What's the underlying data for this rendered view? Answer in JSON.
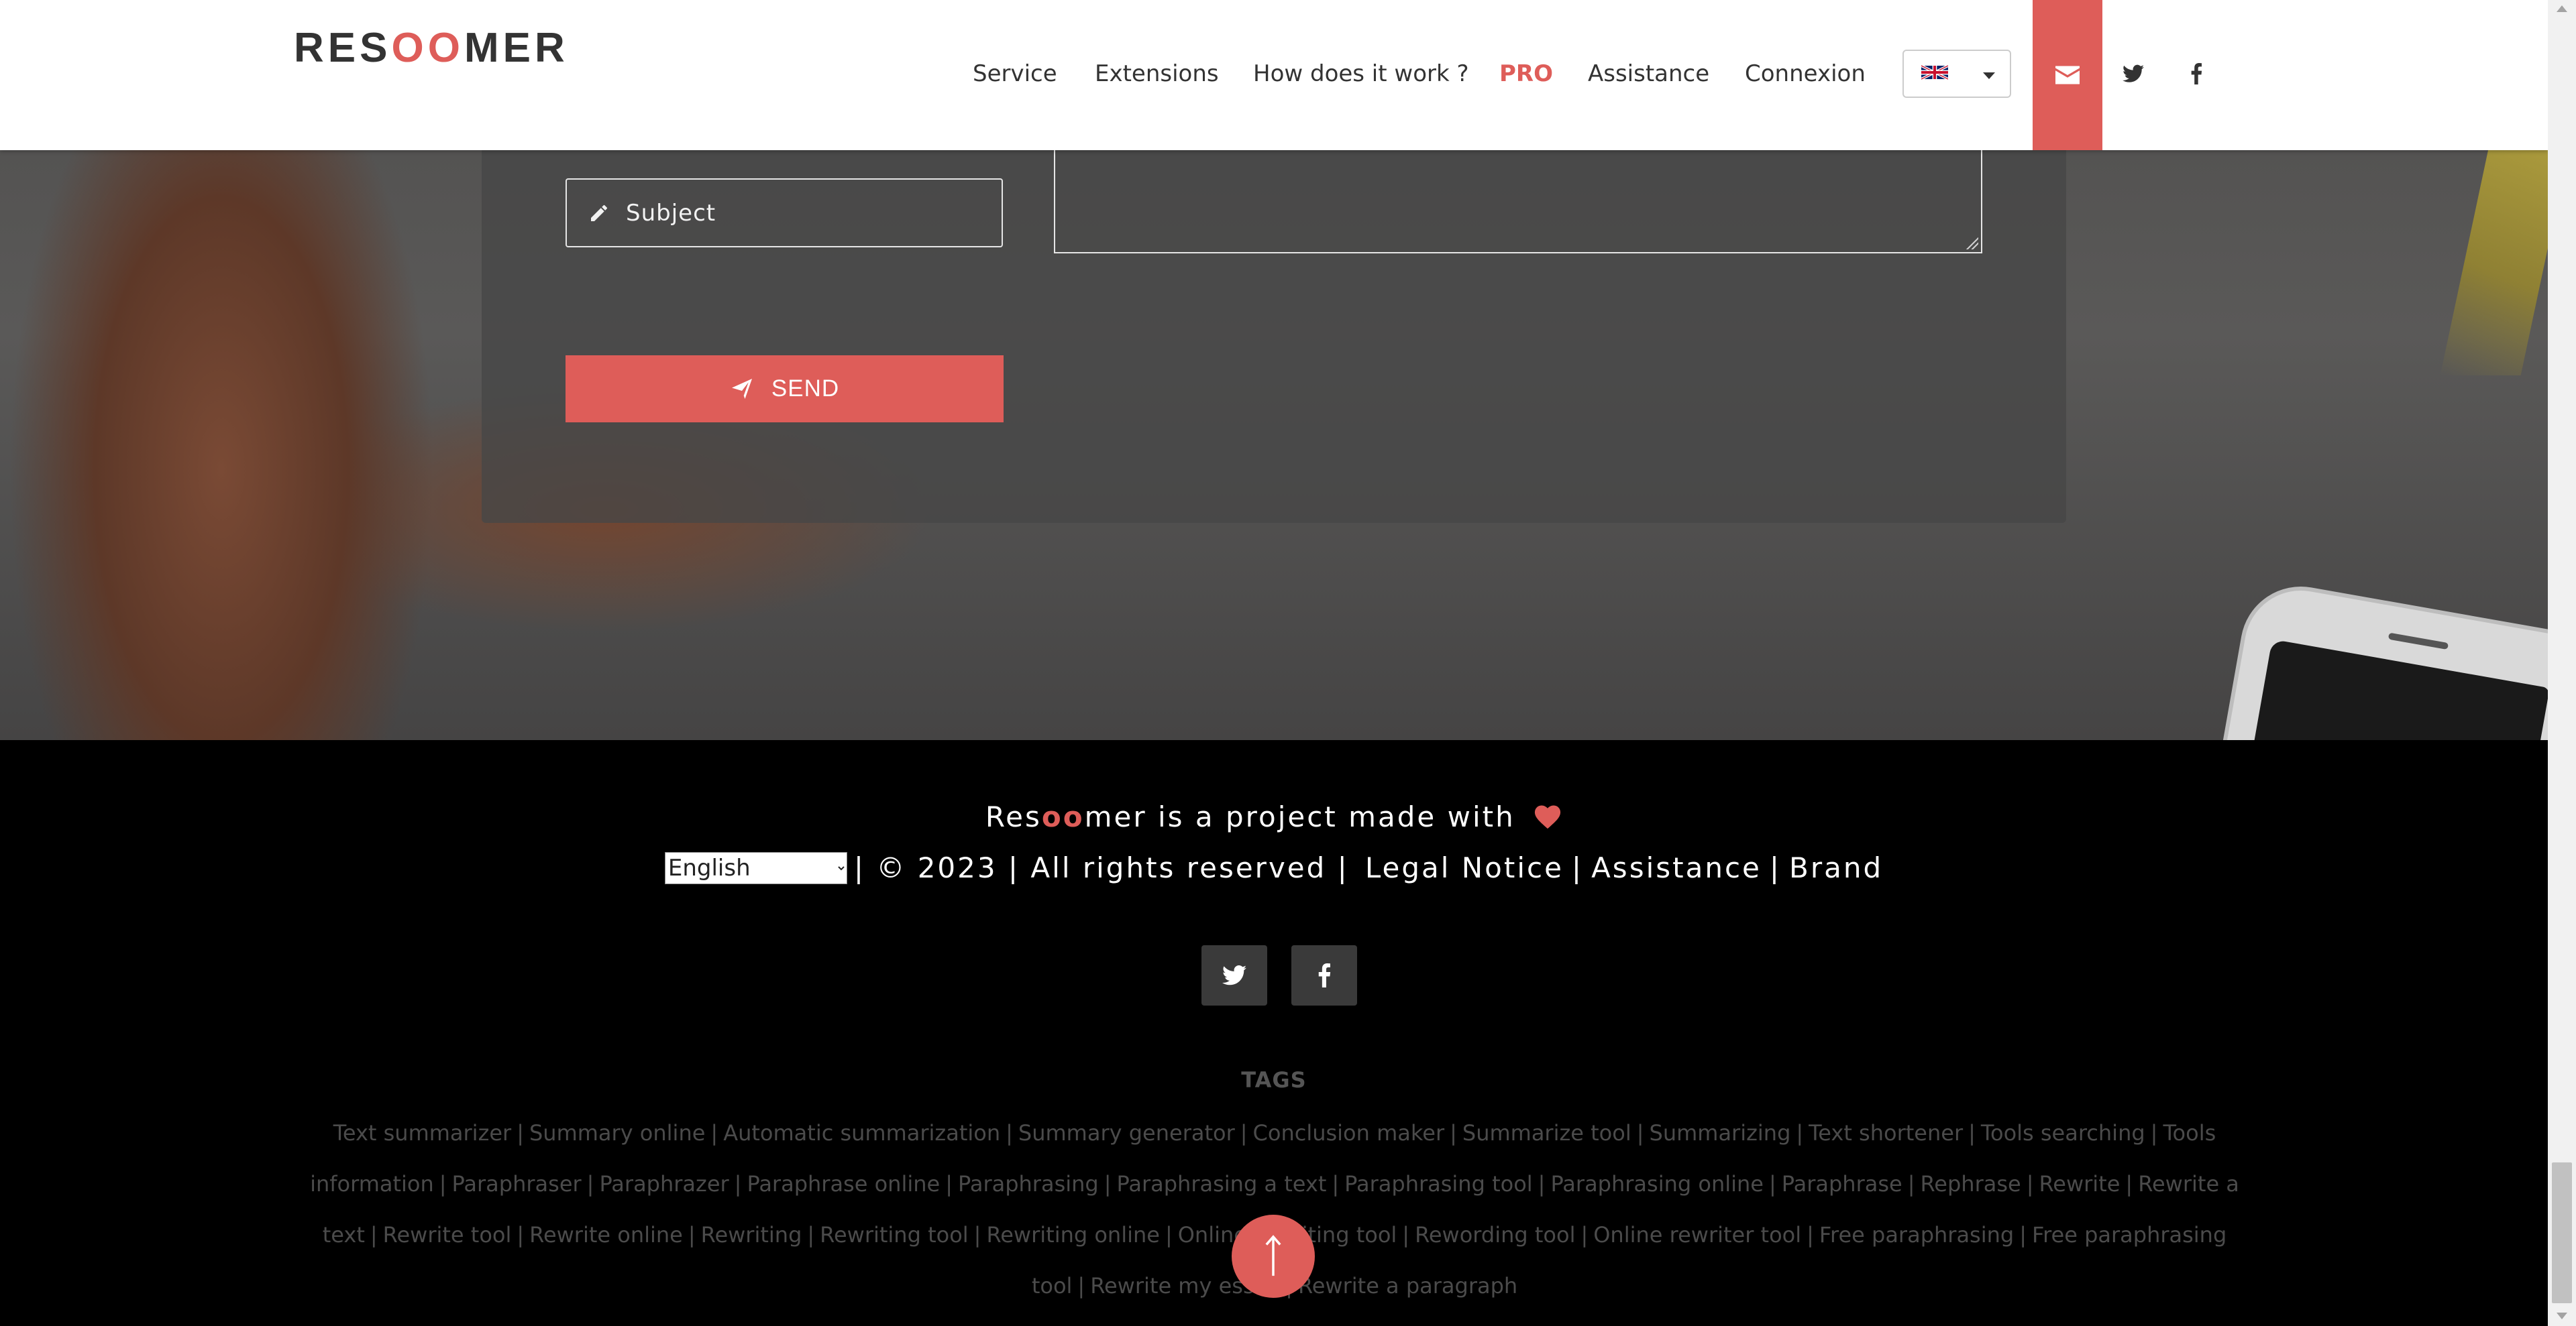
{
  "header": {
    "logo": {
      "pre": "RES",
      "accent": "OO",
      "post": "MER"
    },
    "nav": [
      {
        "label": "Service",
        "name": "nav-service"
      },
      {
        "label": "Extensions",
        "name": "nav-extensions"
      },
      {
        "label": "How does it work ?",
        "name": "nav-how-it-works"
      },
      {
        "label": "PRO",
        "name": "nav-pro"
      },
      {
        "label": "Assistance",
        "name": "nav-assistance"
      },
      {
        "label": "Connexion",
        "name": "nav-connexion"
      }
    ],
    "language_flag": "uk-flag-icon",
    "icons": [
      "envelope-icon",
      "twitter-icon",
      "facebook-icon"
    ]
  },
  "form": {
    "subject_placeholder": "Subject",
    "send_label": "SEND"
  },
  "footer": {
    "made_with": {
      "pre": "Res",
      "accent": "oo",
      "post": "mer is a project made with"
    },
    "language_select": {
      "selected": "English"
    },
    "copyright": "| © 2023 | All rights reserved |",
    "legal_notice": "Legal Notice",
    "assistance": "Assistance",
    "brand": "Brand",
    "tags_title": "TAGS",
    "tags": [
      "Text summarizer",
      "Summary online",
      "Automatic summarization",
      "Summary generator",
      "Conclusion maker",
      "Summarize tool",
      "Summarizing",
      "Text shortener",
      "Tools searching",
      "Tools information",
      "Paraphraser",
      "Paraphrazer",
      "Paraphrase online",
      "Paraphrasing",
      "Paraphrasing a text",
      "Paraphrasing tool",
      "Paraphrasing online",
      "Paraphrase",
      "Rephrase",
      "Rewrite",
      "Rewrite a text",
      "Rewrite tool",
      "Rewrite online",
      "Rewriting",
      "Rewriting tool",
      "Rewriting online",
      "Online rewriting tool",
      "Rewording tool",
      "Online rewriter tool",
      "Free paraphrasing",
      "Free paraphrasing tool",
      "Rewrite my essay",
      "Rewrite a paragraph"
    ]
  },
  "colors": {
    "accent": "#de5d59",
    "footer_bg": "#000000",
    "tag_text": "#4b4b4b"
  }
}
